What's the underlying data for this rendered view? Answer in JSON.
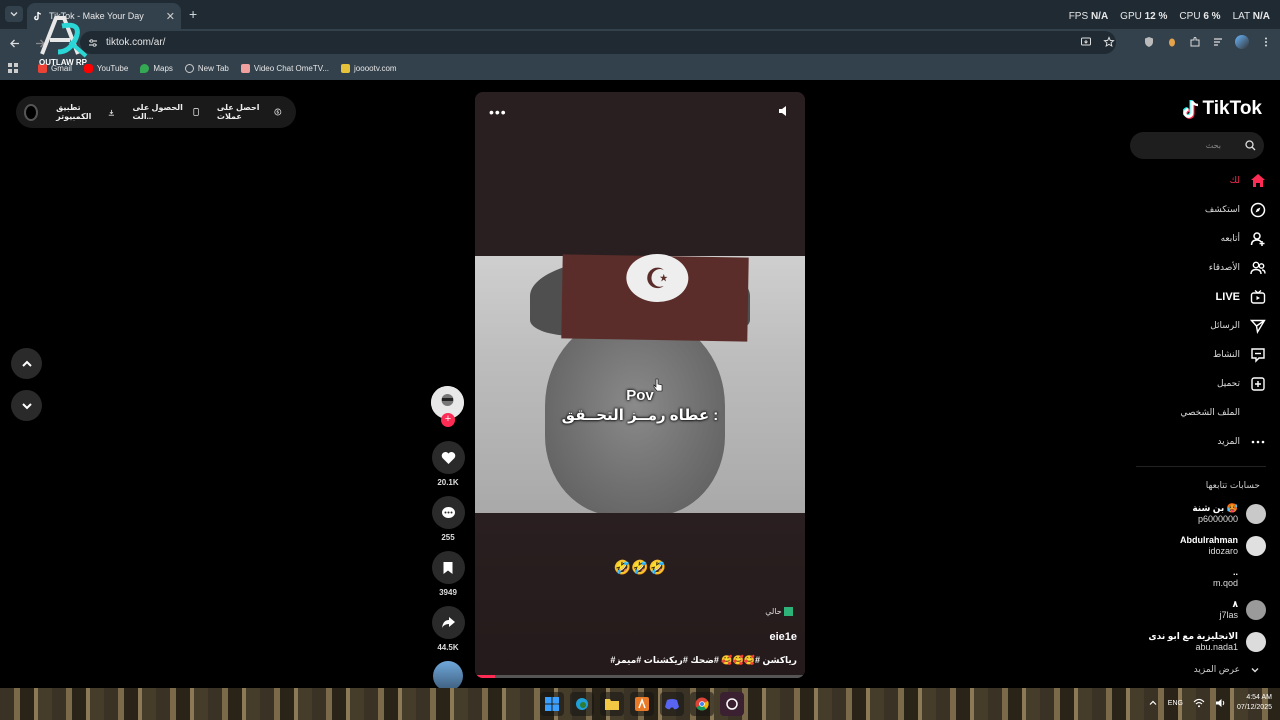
{
  "browser": {
    "tab_title": "TikTok - Make Your Day",
    "url": "tiktok.com/ar/",
    "stats": {
      "fps_label": "FPS",
      "fps_value": "N/A",
      "gpu_label": "GPU",
      "gpu_value": "12 %",
      "cpu_label": "CPU",
      "cpu_value": "6 %",
      "lat_label": "LAT",
      "lat_value": "N/A"
    },
    "bookmarks": [
      "Gmail",
      "YouTube",
      "Maps",
      "New Tab",
      "Video Chat OmeTV...",
      "jooootv.com"
    ],
    "overlay_logo_text": "OUTLAW RP"
  },
  "topbar": {
    "get_coins": "احصل على عملات",
    "get_app": "الحصول على الت...",
    "desktop_app": "تطبيق الكمبيوتر"
  },
  "video": {
    "pov_line1": "Pov",
    "pov_line2": "عطاه رمــز التحــقق :",
    "emoji_line": "🤣🤣🤣",
    "badge": "حالي",
    "author": "eie1e",
    "caption": "#رياكشن #🥰🥰🥰 #ضحك #ريكشنات #ميمز",
    "progress": 0.06
  },
  "actions": {
    "likes": "20.1K",
    "comments": "255",
    "saves": "3949",
    "shares": "44.5K"
  },
  "sidebar": {
    "logo": "TikTok",
    "search_placeholder": "بحث",
    "menu": [
      {
        "label": "لك",
        "icon": "home-icon",
        "active": true
      },
      {
        "label": "استكشف",
        "icon": "compass-icon"
      },
      {
        "label": "أتابعه",
        "icon": "user-follow-icon"
      },
      {
        "label": "الأصدقاء",
        "icon": "friends-icon"
      },
      {
        "label": "LIVE",
        "icon": "live-icon"
      },
      {
        "label": "الرسائل",
        "icon": "send-icon"
      },
      {
        "label": "النشاط",
        "icon": "activity-icon"
      },
      {
        "label": "تحميل",
        "icon": "upload-icon"
      },
      {
        "label": "الملف الشخصي",
        "icon": "profile-icon"
      },
      {
        "label": "المزيد",
        "icon": "more-icon"
      }
    ],
    "following_title": "حسابات تتابعها",
    "accounts": [
      {
        "name": "بن شنة 🥵",
        "user": "p6000000"
      },
      {
        "name": "Abdulrahman",
        "user": "idozaro"
      },
      {
        "name": "..",
        "user": "m.qod"
      },
      {
        "name": "٨",
        "user": "j7las"
      },
      {
        "name": "الانجليزية مع ابو ندى",
        "user": "abu.nada1"
      }
    ],
    "see_more": "عرض المزيد"
  },
  "taskbar": {
    "lang": "ENG",
    "time": "4:54 AM",
    "date": "07/12/2025"
  }
}
